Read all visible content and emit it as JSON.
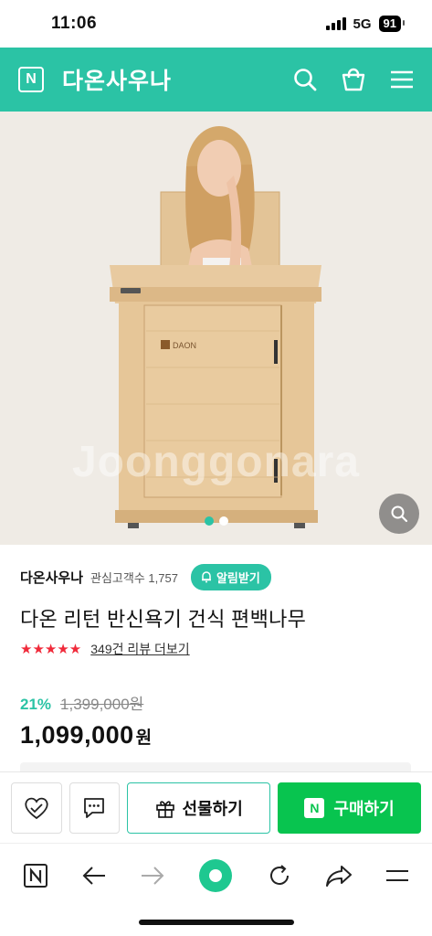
{
  "status": {
    "time": "11:06",
    "network": "5G",
    "battery": "91"
  },
  "header": {
    "logo_letter": "N",
    "store_title": "다온사우나",
    "icons": [
      "search-icon",
      "shopping-bag-icon",
      "menu-icon"
    ],
    "accent_color": "#2bc3a5"
  },
  "hero": {
    "watermark": "Joonggonara",
    "brand_on_cabinet": "DAON",
    "image_count": 2,
    "active_image": 1
  },
  "store": {
    "name": "다온사우나",
    "fans": "관심고객수 1,757",
    "alert_label": "알림받기"
  },
  "product": {
    "name": "다온 리턴 반신욕기 건식 편백나무",
    "stars": "★★★★★",
    "rating": 5,
    "reviews": "349건 리뷰 더보기",
    "discount": "21%",
    "original_price": "1,399,000원",
    "final_price": "1,099,000",
    "currency": "원"
  },
  "actions": {
    "gift_label": "선물하기",
    "buy_label": "구매하기",
    "buy_color": "#08c44f"
  },
  "browser": {
    "icons": [
      "naver-home-icon",
      "back-arrow-icon",
      "forward-arrow-icon",
      "green-dot-icon",
      "reload-icon",
      "share-icon",
      "menu-icon"
    ]
  }
}
